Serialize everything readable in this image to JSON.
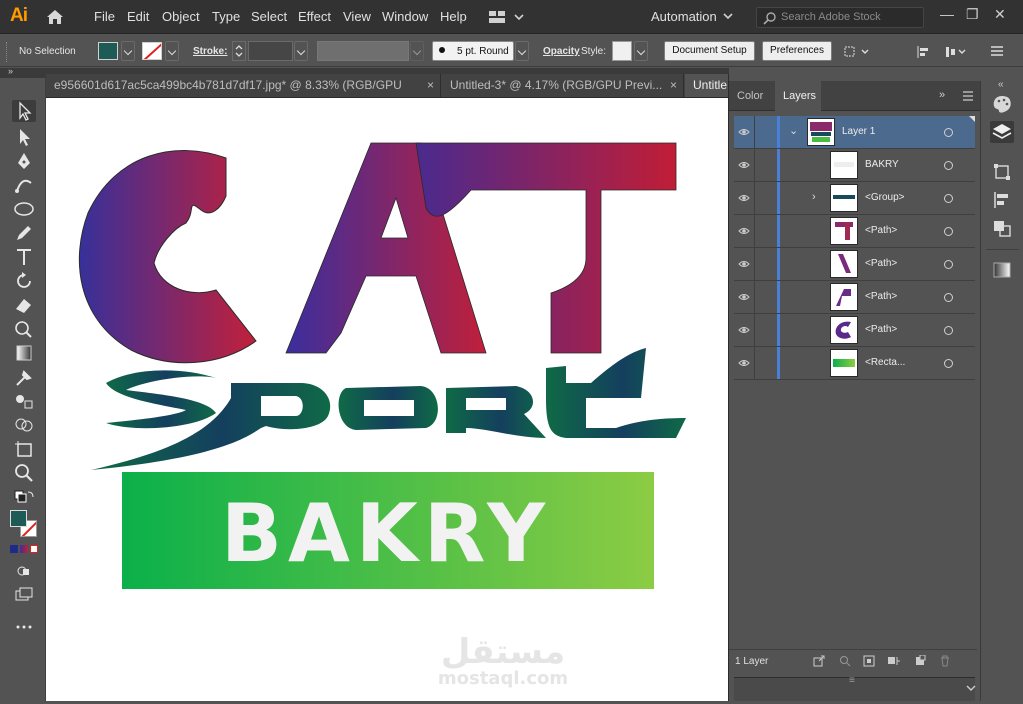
{
  "app": {
    "logo": "Ai"
  },
  "menu": [
    "File",
    "Edit",
    "Object",
    "Type",
    "Select",
    "Effect",
    "View",
    "Window",
    "Help"
  ],
  "workspace": {
    "label": "Automation"
  },
  "search": {
    "placeholder": "Search Adobe Stock"
  },
  "control_bar": {
    "selection": "No Selection",
    "stroke_label": "Stroke:",
    "brush": "5 pt. Round",
    "opacity_label": "Opacity",
    "style_label": "Style:",
    "doc_setup": "Document Setup",
    "preferences": "Preferences",
    "fill_color": "#1e5b56"
  },
  "tabs": [
    {
      "label": "e956601d617ac5ca499bc4b781d7df17.jpg* @ 8.33% (RGB/GPU Previ...",
      "close": "×"
    },
    {
      "label": "Untitled-3* @ 4.17% (RGB/GPU Previ...",
      "close": "×"
    },
    {
      "label": "Untitle"
    }
  ],
  "artwork": {
    "line1": "CAT",
    "line2": "sport",
    "line3": "BAKRY",
    "gradient_start": "#3a2f9a",
    "gradient_end": "#c0203a",
    "green_start": "#0bb04a",
    "green_end": "#8ccc44"
  },
  "watermark": {
    "arabic": "مستقل",
    "latin": "mostaql.com"
  },
  "panel": {
    "tabs": [
      "Color",
      "Layers"
    ],
    "layers": [
      {
        "name": "Layer 1",
        "selected": true
      },
      {
        "name": "BAKRY"
      },
      {
        "name": "<Group>"
      },
      {
        "name": "<Path>"
      },
      {
        "name": "<Path>"
      },
      {
        "name": "<Path>"
      },
      {
        "name": "<Path>"
      },
      {
        "name": "<Recta..."
      }
    ],
    "footer": "1 Layer"
  },
  "window_controls": {
    "min": "—",
    "max": "❐",
    "close": "✕"
  }
}
